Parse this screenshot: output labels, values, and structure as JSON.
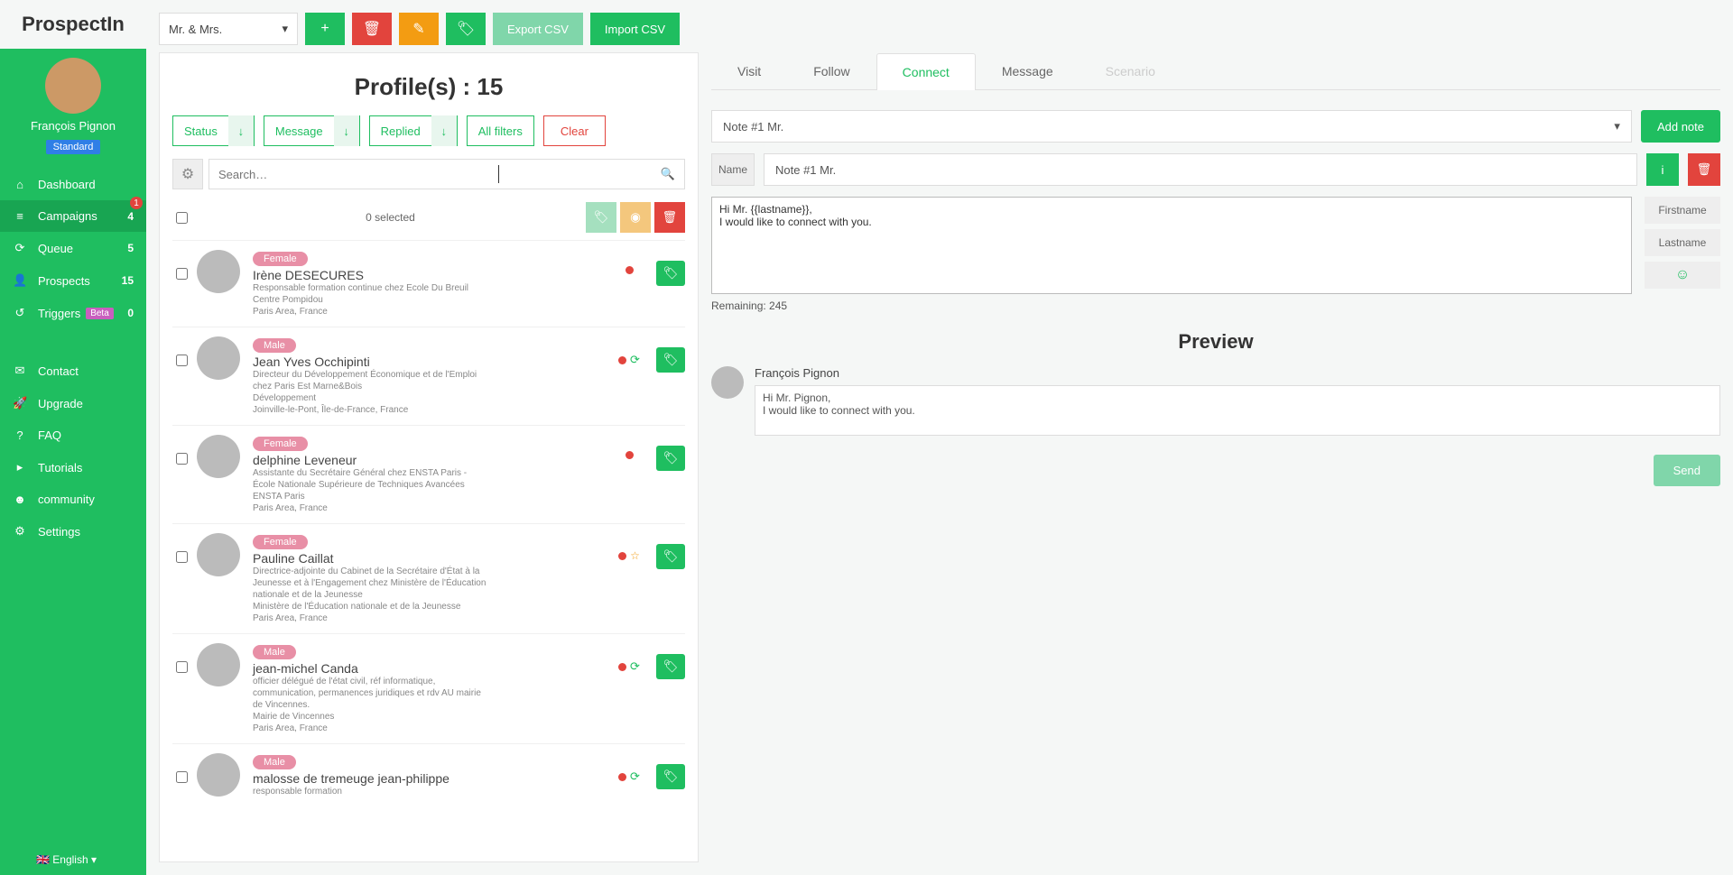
{
  "brand": "ProspectIn",
  "user": {
    "name": "François Pignon",
    "plan": "Standard"
  },
  "nav": {
    "dashboard": "Dashboard",
    "campaigns": {
      "label": "Campaigns",
      "count": "4",
      "badge": "1"
    },
    "queue": {
      "label": "Queue",
      "count": "5"
    },
    "prospects": {
      "label": "Prospects",
      "count": "15"
    },
    "triggers": {
      "label": "Triggers",
      "beta": "Beta",
      "count": "0"
    },
    "contact": "Contact",
    "upgrade": "Upgrade",
    "faq": "FAQ",
    "tutorials": "Tutorials",
    "community": "community",
    "settings": "Settings"
  },
  "lang": "English",
  "topbar": {
    "campaign_select": "Mr. & Mrs.",
    "export_csv": "Export CSV",
    "import_csv": "Import CSV"
  },
  "title": "Profile(s) : 15",
  "filters": {
    "status": "Status",
    "message": "Message",
    "replied": "Replied",
    "all": "All filters",
    "clear": "Clear"
  },
  "search_placeholder": "Search…",
  "selected_text": "0 selected",
  "profiles": [
    {
      "gender": "Female",
      "name": "Irène DESECURES",
      "desc": "Responsable formation continue chez Ecole Du Breuil\nCentre Pompidou\nParis Area, France",
      "refresh": false,
      "star": false
    },
    {
      "gender": "Male",
      "name": "Jean Yves Occhipinti",
      "desc": "Directeur du Développement Économique et de l'Emploi chez Paris Est Marne&Bois\nDéveloppement\nJoinville-le-Pont, Île-de-France, France",
      "refresh": true,
      "star": false
    },
    {
      "gender": "Female",
      "name": "delphine Leveneur",
      "desc": "Assistante du Secrétaire Général chez ENSTA Paris - École Nationale Supérieure de Techniques Avancées\nENSTA Paris\nParis Area, France",
      "refresh": false,
      "star": false
    },
    {
      "gender": "Female",
      "name": "Pauline Caillat",
      "desc": "Directrice-adjointe du Cabinet de la Secrétaire d'État à la Jeunesse et à l'Engagement chez Ministère de l'Éducation nationale et de la Jeunesse\nMinistère de l'Éducation nationale et de la Jeunesse\nParis Area, France",
      "refresh": false,
      "star": true
    },
    {
      "gender": "Male",
      "name": "jean-michel Canda",
      "desc": "officier délégué de l'état civil, réf informatique, communication, permanences juridiques et rdv AU mairie de Vincennes.\nMairie de Vincennes\nParis Area, France",
      "refresh": true,
      "star": false
    },
    {
      "gender": "Male",
      "name": "malosse de tremeuge jean-philippe",
      "desc": "responsable formation",
      "refresh": true,
      "star": false
    }
  ],
  "tabs": {
    "visit": "Visit",
    "follow": "Follow",
    "connect": "Connect",
    "message": "Message",
    "scenario": "Scenario"
  },
  "note": {
    "select": "Note #1 Mr.",
    "add": "Add note",
    "name_label": "Name",
    "name_value": "Note #1 Mr.",
    "body": "Hi Mr. {{lastname}},\nI would like to connect with you.",
    "firstname_btn": "Firstname",
    "lastname_btn": "Lastname",
    "remaining": "Remaining: 245"
  },
  "preview": {
    "title": "Preview",
    "name": "François Pignon",
    "msg": "Hi Mr. Pignon,\nI would like to connect with you.",
    "send": "Send"
  }
}
